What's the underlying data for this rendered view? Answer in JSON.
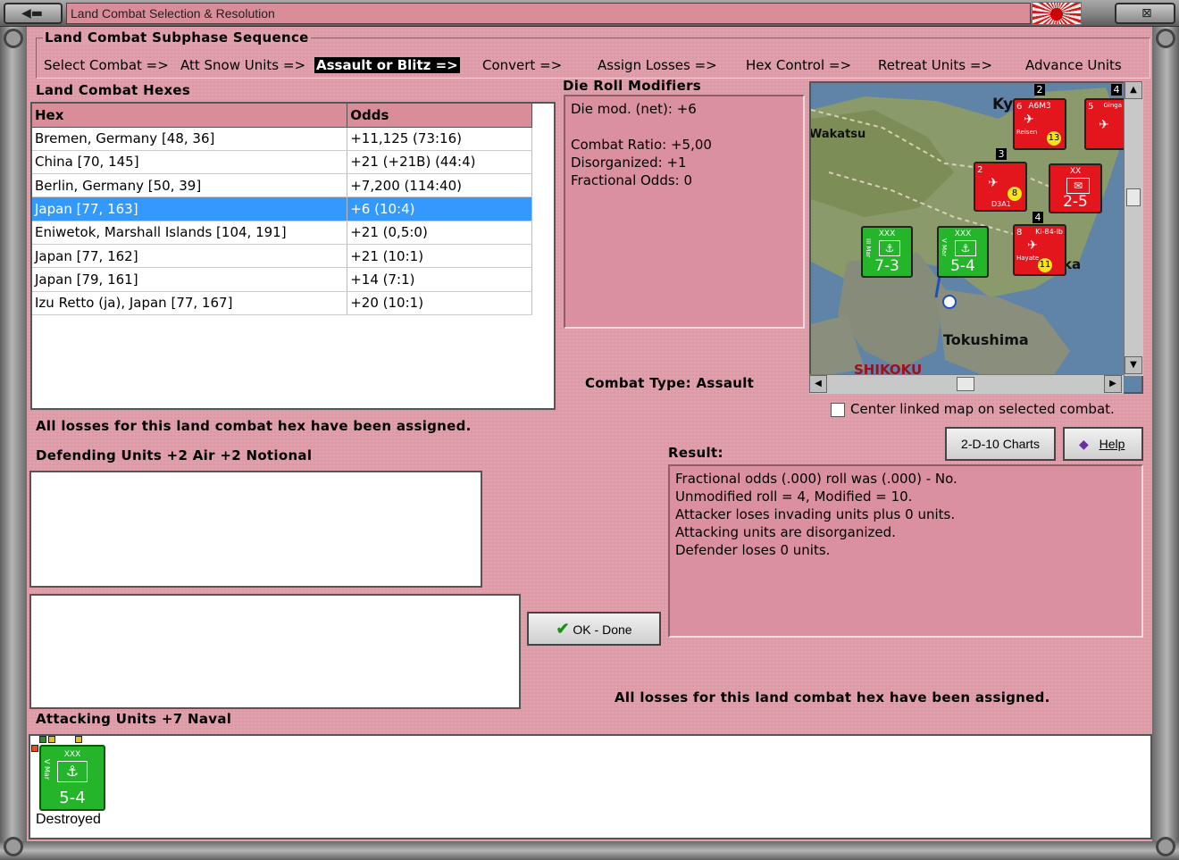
{
  "window": {
    "title": "Land Combat Selection & Resolution"
  },
  "sequence": {
    "title": "Land Combat Subphase Sequence",
    "steps": [
      "Select Combat =>",
      "Att Snow Units =>",
      "Assault or Blitz =>",
      "Convert =>",
      "Assign Losses =>",
      "Hex Control =>",
      "Retreat Units =>",
      "Advance Units"
    ],
    "active_index": 2
  },
  "hexes": {
    "label": "Land Combat Hexes",
    "headers": [
      "Hex",
      "Odds"
    ],
    "rows": [
      [
        "Bremen, Germany [48, 36]",
        "+11,125 (73:16)"
      ],
      [
        "China [70, 145]",
        "+21 (+21B) (44:4)"
      ],
      [
        "Berlin, Germany [50, 39]",
        "+7,200 (114:40)"
      ],
      [
        "Japan [77, 163]",
        "+6 (10:4)"
      ],
      [
        "Eniwetok, Marshall Islands [104, 191]",
        "+21 (0,5:0)"
      ],
      [
        "Japan [77, 162]",
        "+21 (10:1)"
      ],
      [
        "Japan [79, 161]",
        "+14 (7:1)"
      ],
      [
        "Izu Retto (ja), Japan [77, 167]",
        "+20 (10:1)"
      ]
    ],
    "selected_index": 3
  },
  "modifiers": {
    "label": "Die Roll Modifiers",
    "lines": [
      "Die mod. (net): +6",
      "",
      "Combat Ratio: +5,00",
      "Disorganized: +1",
      "Fractional Odds: 0"
    ]
  },
  "combat_type": "Combat Type:  Assault",
  "map": {
    "labels": [
      "Ky",
      "Wakatsu",
      "Tokushima",
      "SHIKOKU",
      "ka"
    ],
    "counters": {
      "c1": {
        "top": "XXX",
        "side": "III Mar",
        "str": "7-3"
      },
      "c2": {
        "top": "XXX",
        "side": "V Mar",
        "str": "5-4"
      },
      "c3": {
        "top": "A6M3",
        "side": "6",
        "num": "13",
        "sub": "Reisen"
      },
      "c4": {
        "top": "D3A1",
        "side": "2",
        "num": "8"
      },
      "c5": {
        "top": "XX",
        "str": "2-5"
      },
      "c6": {
        "top": "Ki-84-Ib",
        "side": "8",
        "num": "11",
        "sub": "Hayate"
      },
      "c7": {
        "top": "Ginga",
        "side": "5"
      }
    },
    "stack_numbers": [
      "2",
      "4",
      "3",
      "4"
    ]
  },
  "center_linked": "Center linked map on selected combat.",
  "losses_note": "All losses for this land combat hex have been assigned.",
  "defending_label": "Defending Units +2 Air +2 Notional",
  "result": {
    "label": "Result:",
    "lines": [
      "Fractional odds (.000) roll was (.000)  - No.",
      "Unmodified roll = 4, Modified = 10.",
      "Attacker loses invading units plus 0 units.",
      "Attacking units are disorganized.",
      "Defender loses 0 units."
    ]
  },
  "buttons": {
    "charts": "2-D-10 Charts",
    "help": "Help",
    "ok": "OK - Done"
  },
  "attacking_label": "Attacking Units +7 Naval",
  "attacking_unit": {
    "top": "XXX",
    "side": "V Mar",
    "str": "5-4",
    "status": "Destroyed"
  },
  "colors": {
    "panel": "#e0a0ab",
    "header": "#d98d99",
    "selection": "#3399ff",
    "unit_green": "#25b52a",
    "unit_red": "#e3161d"
  }
}
